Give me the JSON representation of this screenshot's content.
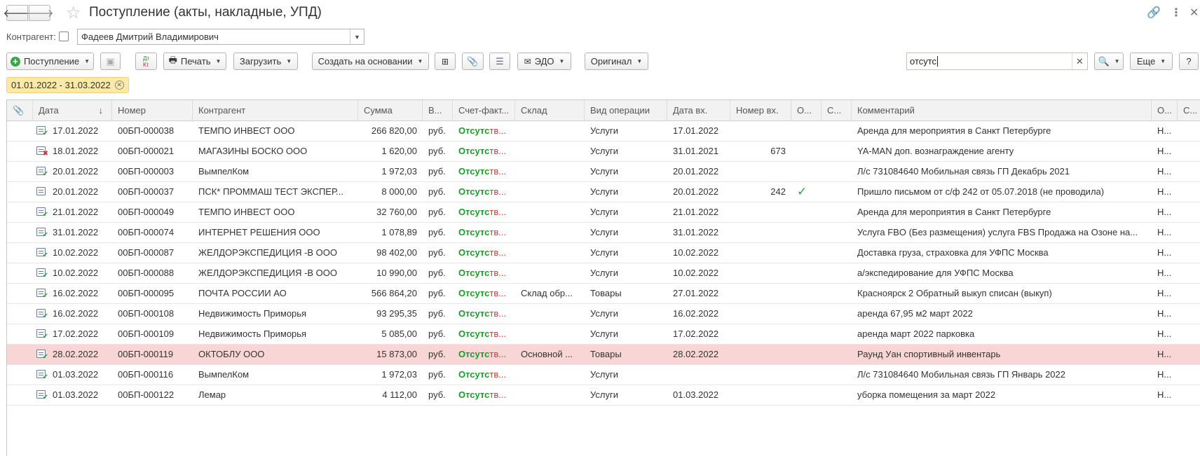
{
  "window": {
    "title": "Поступление (акты, накладные, УПД)"
  },
  "filters": {
    "kontragent_label": "Контрагент:",
    "kontragent_value": "Фадеев Дмитрий Владимирович",
    "period": "01.01.2022 - 31.03.2022"
  },
  "toolbar": {
    "postuplenie": "Поступление",
    "dt_kt": "Дт Кт",
    "print": "Печать",
    "load": "Загрузить",
    "create_based": "Создать на основании",
    "edo": "ЭДО",
    "original": "Оригинал",
    "search_value": "отсутс",
    "more": "Еще",
    "help": "?"
  },
  "table": {
    "columns": [
      "Дата",
      "Номер",
      "Контрагент",
      "Сумма",
      "В...",
      "Счет-факт...",
      "Склад",
      "Вид операции",
      "Дата вх.",
      "Номер вх.",
      "О...",
      "С...",
      "Комментарий",
      "О...",
      "С..."
    ],
    "sort_indicator": "↓",
    "rows": [
      {
        "status": "ok",
        "date": "17.01.2022",
        "number": "00БП-000038",
        "kontragent": "ТЕМПО ИНВЕСТ ООО",
        "sum": "266 820,00",
        "cur": "руб.",
        "sf_a": "Отсутс",
        "sf_b": "тв...",
        "sklad": "",
        "op": "Услуги",
        "date_in": "17.01.2022",
        "num_in": "",
        "o": "",
        "comment": "Аренда для мероприятия в Санкт Петербурге",
        "o2": "Н..."
      },
      {
        "status": "del",
        "date": "18.01.2022",
        "number": "00БП-000021",
        "kontragent": "МАГАЗИНЫ БОСКО ООО",
        "sum": "1 620,00",
        "cur": "руб.",
        "sf_a": "Отсутс",
        "sf_b": "тв...",
        "sklad": "",
        "op": "Услуги",
        "date_in": "31.01.2021",
        "num_in": "673",
        "o": "",
        "comment": "YA-MAN доп. вознаграждение агенту",
        "o2": "Н..."
      },
      {
        "status": "ok",
        "date": "20.01.2022",
        "number": "00БП-000003",
        "kontragent": "ВымпелКом",
        "sum": "1 972,03",
        "cur": "руб.",
        "sf_a": "Отсутс",
        "sf_b": "тв...",
        "sklad": "",
        "op": "Услуги",
        "date_in": "20.01.2022",
        "num_in": "",
        "o": "",
        "comment": "Л/с 731084640 Мобильная связь ГП Декабрь 2021",
        "o2": "Н..."
      },
      {
        "status": "none",
        "date": "20.01.2022",
        "number": "00БП-000037",
        "kontragent": " ПСК* ПРОММАШ ТЕСТ ЭКСПЕР...",
        "sum": "8 000,00",
        "cur": "руб.",
        "sf_a": "Отсутс",
        "sf_b": "тв...",
        "sklad": "",
        "op": "Услуги",
        "date_in": "20.01.2022",
        "num_in": "242",
        "o": "✓",
        "comment": "Пришло письмом от с/ф 242 от 05.07.2018 (не проводила)",
        "o2": "Н..."
      },
      {
        "status": "ok",
        "date": "21.01.2022",
        "number": "00БП-000049",
        "kontragent": "ТЕМПО ИНВЕСТ ООО",
        "sum": "32 760,00",
        "cur": "руб.",
        "sf_a": "Отсутс",
        "sf_b": "тв...",
        "sklad": "",
        "op": "Услуги",
        "date_in": "21.01.2022",
        "num_in": "",
        "o": "",
        "comment": "Аренда для мероприятия в Санкт Петербурге",
        "o2": "Н..."
      },
      {
        "status": "ok",
        "date": "31.01.2022",
        "number": "00БП-000074",
        "kontragent": "ИНТЕРНЕТ РЕШЕНИЯ ООО",
        "sum": "1 078,89",
        "cur": "руб.",
        "sf_a": "Отсутс",
        "sf_b": "тв...",
        "sklad": "",
        "op": "Услуги",
        "date_in": "31.01.2022",
        "num_in": "",
        "o": "",
        "comment": "Услуга FBO (Без размещения) услуга FBS Продажа на Озоне на...",
        "o2": "Н..."
      },
      {
        "status": "ok",
        "date": "10.02.2022",
        "number": "00БП-000087",
        "kontragent": "ЖЕЛДОРЭКСПЕДИЦИЯ -В ООО",
        "sum": "98 402,00",
        "cur": "руб.",
        "sf_a": "Отсутс",
        "sf_b": "тв...",
        "sklad": "",
        "op": "Услуги",
        "date_in": "10.02.2022",
        "num_in": "",
        "o": "",
        "comment": "Доставка груза, страховка для УФПС Москва",
        "o2": "Н..."
      },
      {
        "status": "ok",
        "date": "10.02.2022",
        "number": "00БП-000088",
        "kontragent": "ЖЕЛДОРЭКСПЕДИЦИЯ -В ООО",
        "sum": "10 990,00",
        "cur": "руб.",
        "sf_a": "Отсутс",
        "sf_b": "тв...",
        "sklad": "",
        "op": "Услуги",
        "date_in": "10.02.2022",
        "num_in": "",
        "o": "",
        "comment": " а/экспедирование для УФПС Москва",
        "o2": "Н..."
      },
      {
        "status": "ok",
        "date": "16.02.2022",
        "number": "00БП-000095",
        "kontragent": "ПОЧТА РОССИИ АО",
        "sum": "566 864,20",
        "cur": "руб.",
        "sf_a": "Отсутс",
        "sf_b": "тв...",
        "sklad": "Склад обр...",
        "op": "Товары",
        "date_in": "27.01.2022",
        "num_in": "",
        "o": "",
        "comment": "Красноярск 2 Обратный выкуп списан (выкуп)",
        "o2": "Н..."
      },
      {
        "status": "ok",
        "date": "16.02.2022",
        "number": "00БП-000108",
        "kontragent": "Недвижимость Приморья",
        "sum": "93 295,35",
        "cur": "руб.",
        "sf_a": "Отсутс",
        "sf_b": "тв...",
        "sklad": "",
        "op": "Услуги",
        "date_in": "16.02.2022",
        "num_in": "",
        "o": "",
        "comment": "аренда 67,95 м2 март 2022",
        "o2": "Н..."
      },
      {
        "status": "ok",
        "date": "17.02.2022",
        "number": "00БП-000109",
        "kontragent": "Недвижимость Приморья",
        "sum": "5 085,00",
        "cur": "руб.",
        "sf_a": "Отсутс",
        "sf_b": "тв...",
        "sklad": "",
        "op": "Услуги",
        "date_in": "17.02.2022",
        "num_in": "",
        "o": "",
        "comment": "аренда март 2022 парковка",
        "o2": "Н..."
      },
      {
        "status": "ok",
        "highlight": true,
        "date": "28.02.2022",
        "number": "00БП-000119",
        "kontragent": "ОКТОБЛУ ООО",
        "sum": "15 873,00",
        "cur": "руб.",
        "sf_a": "Отсутс",
        "sf_b": "тв...",
        "sklad": "Основной ...",
        "op": "Товары",
        "date_in": "28.02.2022",
        "num_in": "",
        "o": "",
        "comment": "Раунд Уан спортивный инвентарь",
        "o2": "Н..."
      },
      {
        "status": "ok",
        "date": "01.03.2022",
        "number": "00БП-000116",
        "kontragent": "ВымпелКом",
        "sum": "1 972,03",
        "cur": "руб.",
        "sf_a": "Отсутс",
        "sf_b": "тв...",
        "sklad": "",
        "op": "Услуги",
        "date_in": "",
        "num_in": "",
        "o": "",
        "comment": "Л/с 731084640 Мобильная связь ГП Январь 2022",
        "o2": "Н..."
      },
      {
        "status": "ok",
        "date": "01.03.2022",
        "number": "00БП-000122",
        "kontragent": "Лемар",
        "sum": "4 112,00",
        "cur": "руб.",
        "sf_a": "Отсутс",
        "sf_b": "тв...",
        "sklad": "",
        "op": "Услуги",
        "date_in": "01.03.2022",
        "num_in": "",
        "o": "",
        "comment": "уборка помещения за март 2022",
        "o2": "Н..."
      }
    ]
  }
}
